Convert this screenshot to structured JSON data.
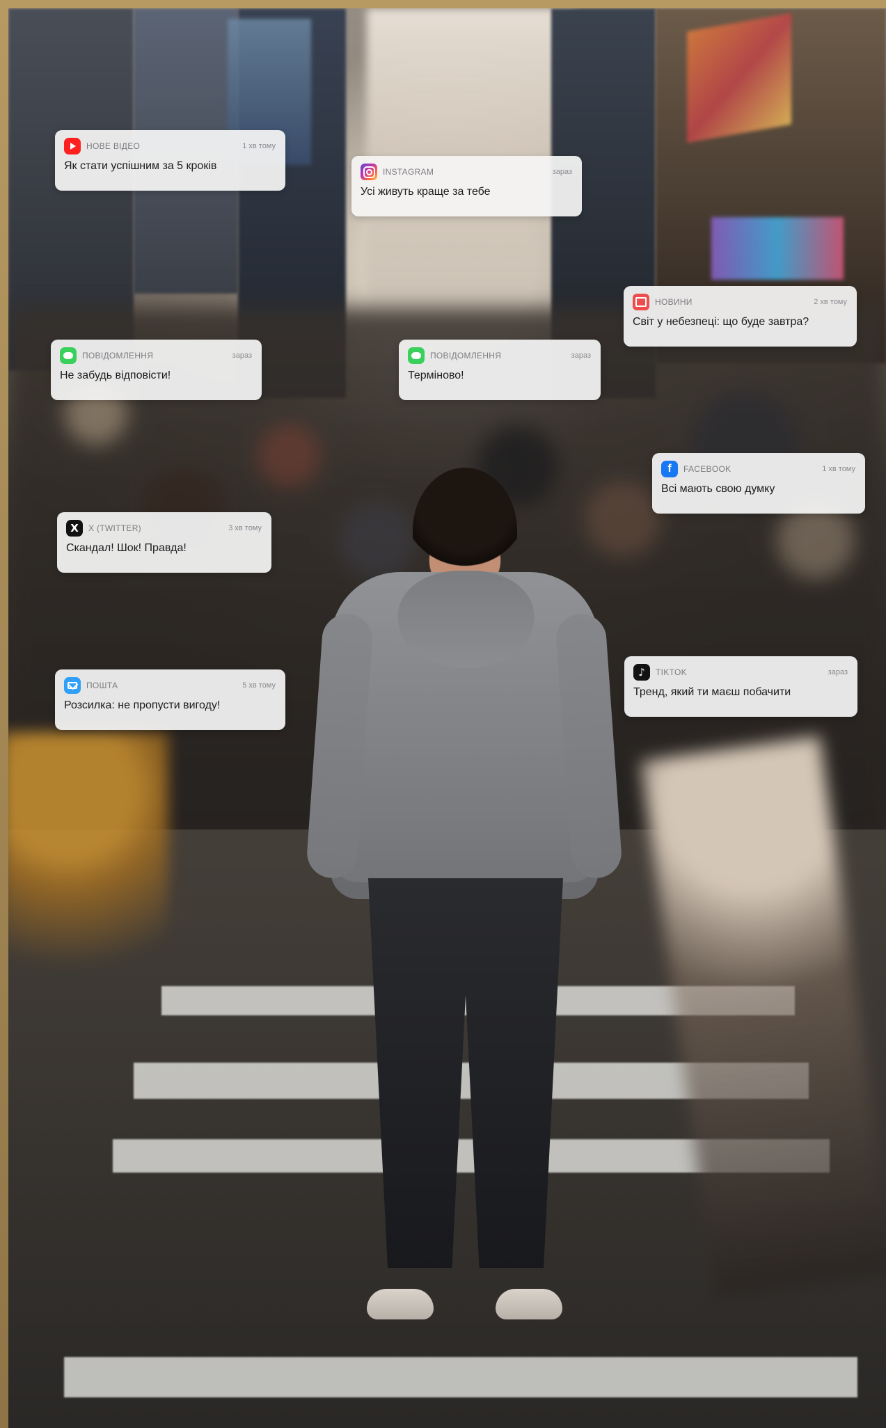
{
  "notifications": [
    {
      "app": "НОВЕ ВІДЕО",
      "time": "1 хв тому",
      "message": "Як стати успішним за 5 кроків",
      "icon": "youtube-icon"
    },
    {
      "app": "INSTAGRAM",
      "time": "зараз",
      "message": "Усі живуть краще за тебе",
      "icon": "instagram-icon"
    },
    {
      "app": "НОВИНИ",
      "time": "2 хв тому",
      "message": "Світ у небезпеці: що буде завтра?",
      "icon": "news-icon"
    },
    {
      "app": "ПОВІДОМЛЕННЯ",
      "time": "зараз",
      "message": "Не забудь відповісти!",
      "icon": "message-icon"
    },
    {
      "app": "ПОВІДОМЛЕННЯ",
      "time": "зараз",
      "message": "Терміново!",
      "icon": "message-icon"
    },
    {
      "app": "FACEBOOK",
      "time": "1 хв тому",
      "message": "Всі мають свою думку",
      "icon": "facebook-icon"
    },
    {
      "app": "X (TWITTER)",
      "time": "3 хв тому",
      "message": "Скандал! Шок! Правда!",
      "icon": "x-icon"
    },
    {
      "app": "ПОШТА",
      "time": "5 хв тому",
      "message": "Розсилка: не пропусти вигоду!",
      "icon": "mail-icon"
    },
    {
      "app": "TIKTOK",
      "time": "зараз",
      "message": "Тренд, який ти маєш побачити",
      "icon": "tiktok-icon"
    }
  ],
  "scene": {
    "frame_color": "#a98b58",
    "accent_notification_bg": "#f5f5f5"
  }
}
